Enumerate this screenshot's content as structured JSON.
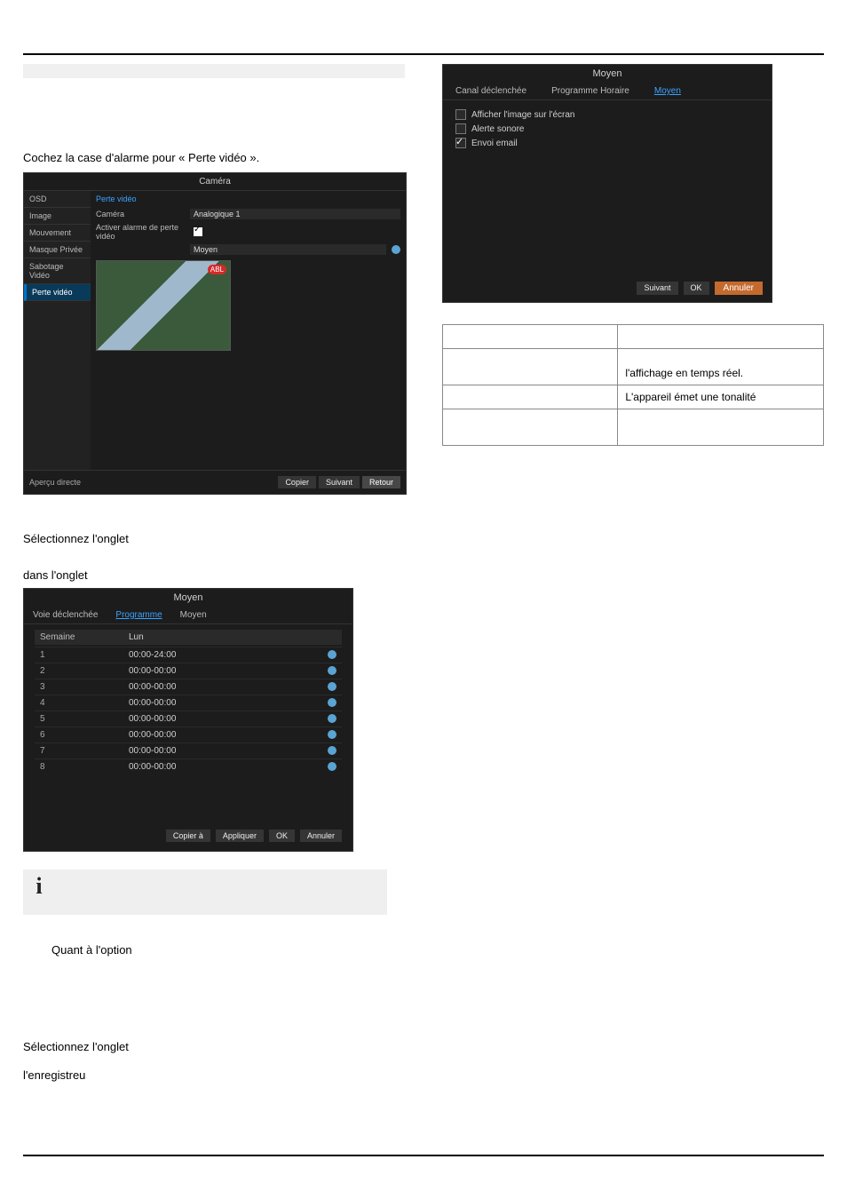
{
  "text": {
    "para_cochez": "Cochez la case d'alarme pour « Perte vidéo ».",
    "para_sel1": "Sélectionnez l'onglet",
    "para_dans": "dans l'onglet",
    "para_quant": "Quant à l'option",
    "para_sel2": "Sélectionnez l'onglet",
    "para_enreg": "l'enregistreu",
    "opt_r1": "l'affichage en temps réel.",
    "opt_r2": "L'appareil émet une tonalité"
  },
  "camera_panel": {
    "title": "Caméra",
    "sidebar": [
      "OSD",
      "Image",
      "Mouvement",
      "Masque Privée",
      "Sabotage Vidéo",
      "Perte vidéo"
    ],
    "sidebar_sel": 5,
    "crumb": "Perte vidéo",
    "row_camera_label": "Caméra",
    "row_camera_value": "Analogique 1",
    "row_enable_label": "Activer alarme de perte vidéo",
    "row_moyen": "Moyen",
    "preview_badge": "ABL",
    "footer_label": "Aperçu directe",
    "btn_copier": "Copier",
    "btn_suivant": "Suivant",
    "btn_retour": "Retour"
  },
  "schedule_panel": {
    "title": "Moyen",
    "tabs": [
      "Voie déclenchée",
      "Programme",
      "Moyen"
    ],
    "tab_on": 1,
    "hdr_semaine": "Semaine",
    "hdr_day": "Lun",
    "rows": [
      {
        "n": "1",
        "t": "00:00-24:00"
      },
      {
        "n": "2",
        "t": "00:00-00:00"
      },
      {
        "n": "3",
        "t": "00:00-00:00"
      },
      {
        "n": "4",
        "t": "00:00-00:00"
      },
      {
        "n": "5",
        "t": "00:00-00:00"
      },
      {
        "n": "6",
        "t": "00:00-00:00"
      },
      {
        "n": "7",
        "t": "00:00-00:00"
      },
      {
        "n": "8",
        "t": "00:00-00:00"
      }
    ],
    "btn_copier_a": "Copier à",
    "btn_appliquer": "Appliquer",
    "btn_ok": "OK",
    "btn_annuler": "Annuler"
  },
  "moyen_panel": {
    "title": "Moyen",
    "tabs": [
      "Canal déclenchée",
      "Programme Horaire",
      "Moyen"
    ],
    "tab_on": 2,
    "items": [
      {
        "label": "Afficher l'image sur l'écran",
        "on": false
      },
      {
        "label": "Alerte sonore",
        "on": false
      },
      {
        "label": "Envoi email",
        "on": true
      }
    ],
    "btn_suivant": "Suivant",
    "btn_ok": "OK",
    "btn_annuler": "Annuler"
  }
}
